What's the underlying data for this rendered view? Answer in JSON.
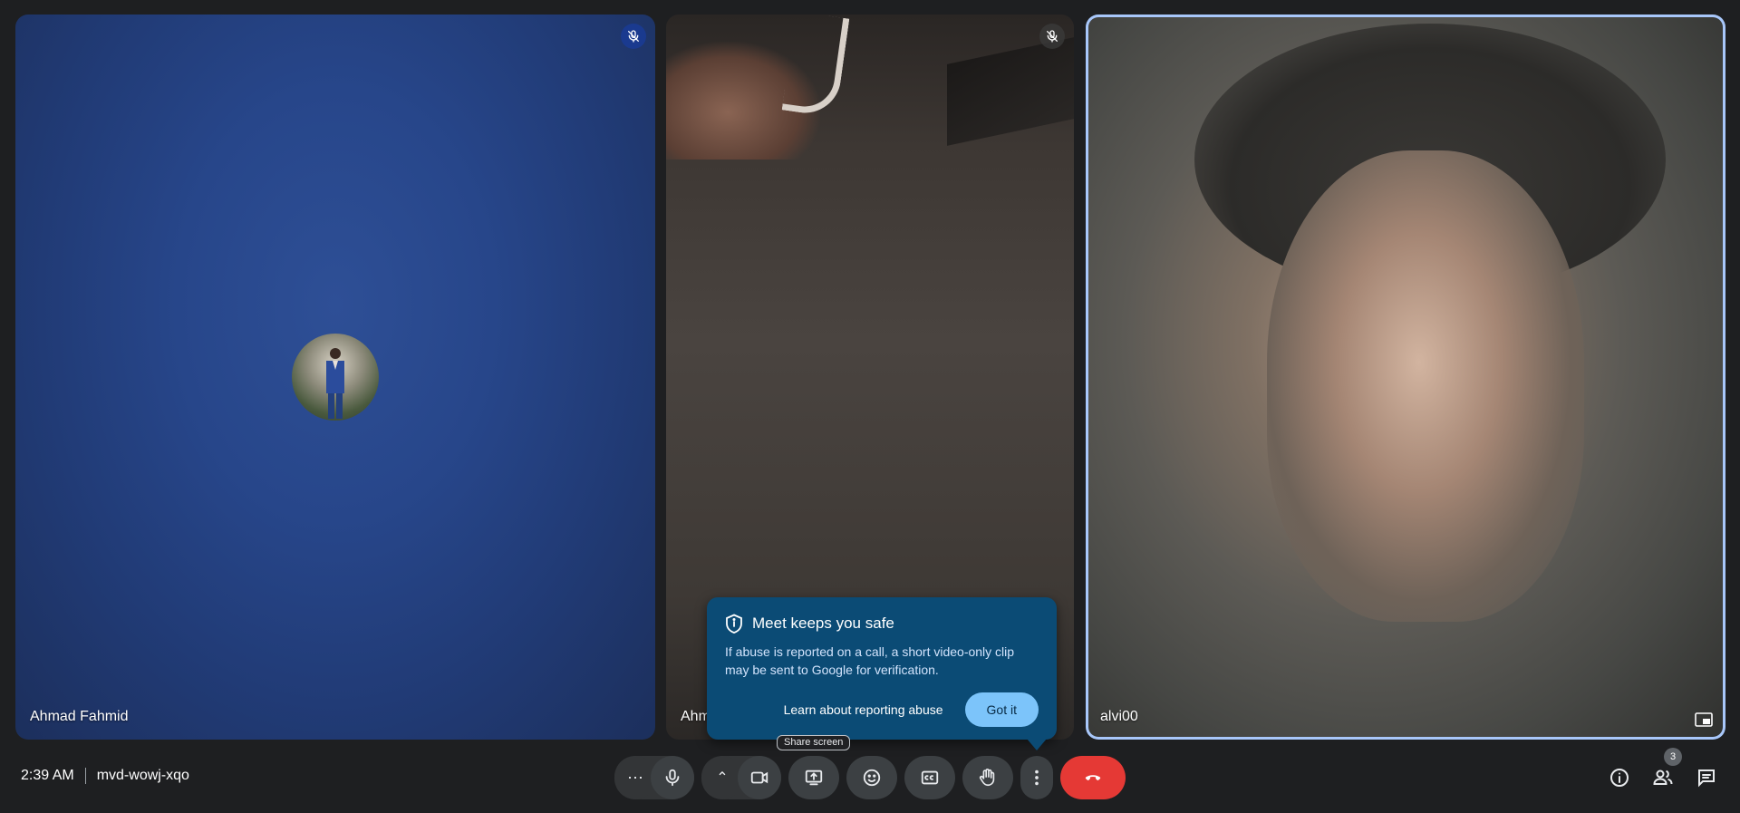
{
  "participants": [
    {
      "name": "Ahmad Fahmid",
      "muted": true,
      "camera": "off"
    },
    {
      "name": "Ahm",
      "muted": true,
      "camera": "on"
    },
    {
      "name": "alvi00",
      "muted": false,
      "camera": "on",
      "active": true
    }
  ],
  "safety_popup": {
    "title": "Meet keeps you safe",
    "body": "If abuse is reported on a call, a short video-only clip may be sent to Google for verification.",
    "learn_link": "Learn about reporting abuse",
    "confirm_button": "Got it"
  },
  "tooltip": "Share screen",
  "meeting": {
    "time": "2:39 AM",
    "code": "mvd-wowj-xqo"
  },
  "people_count": "3",
  "controls": {
    "more_audio": "⋯",
    "more_video": "⌃"
  },
  "colors": {
    "background": "#202124",
    "end_call": "#e53935",
    "active_border": "#a8c7fa",
    "popup": "#0b4b75",
    "confirm_button": "#7cc4fa"
  }
}
